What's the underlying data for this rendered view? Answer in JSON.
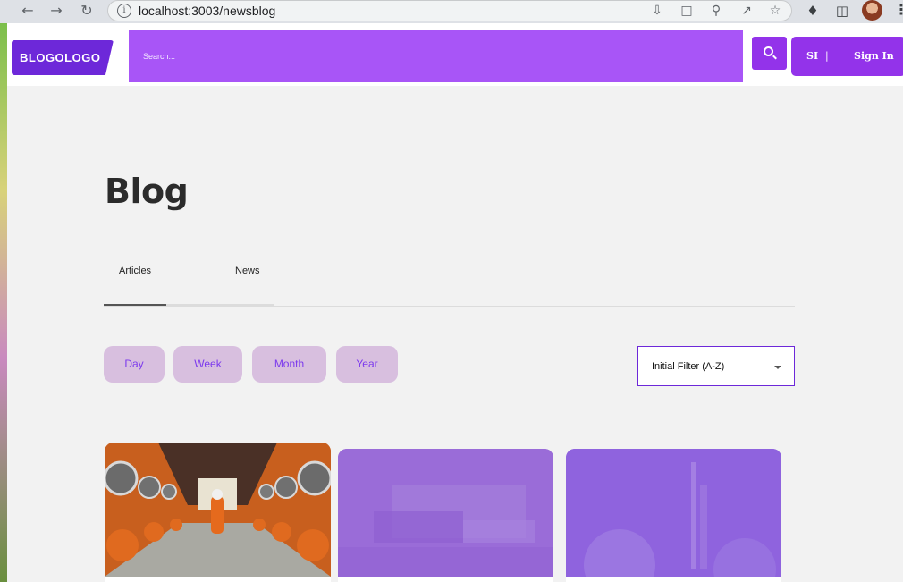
{
  "browser": {
    "url": "localhost:3003/newsblog",
    "icons": [
      "back-icon",
      "forward-icon",
      "reload-icon",
      "site-info-icon",
      "install-icon",
      "translate-icon",
      "zoom-icon",
      "share-icon",
      "bookmark-star-icon",
      "extensions-icon",
      "side-panel-icon",
      "profile-avatar",
      "menu-kebab-icon"
    ]
  },
  "header": {
    "logo": "BLOGOLOGO",
    "search_placeholder": "Search...",
    "auth_initials": "SI",
    "auth_separator": "|",
    "auth_label": "Sign In"
  },
  "main": {
    "title": "Blog",
    "tabs": [
      {
        "label": "Articles",
        "active": true
      },
      {
        "label": "News",
        "active": false
      }
    ],
    "period_filters": [
      "Day",
      "Week",
      "Month",
      "Year"
    ],
    "sort_select": {
      "selected": "Initial Filter (A-Z)"
    }
  },
  "cards": [
    {
      "image": "orange-corridor-astronaut"
    },
    {
      "image": "purple-facility-aerial"
    },
    {
      "image": "purple-rocket-launch"
    }
  ],
  "colors": {
    "brand_dark": "#6d28d9",
    "brand": "#a855f7",
    "button": "#9333ea",
    "pill_bg": "#d8bfdf",
    "pill_text": "#7c3aed",
    "page_bg": "#f2f2f2"
  }
}
